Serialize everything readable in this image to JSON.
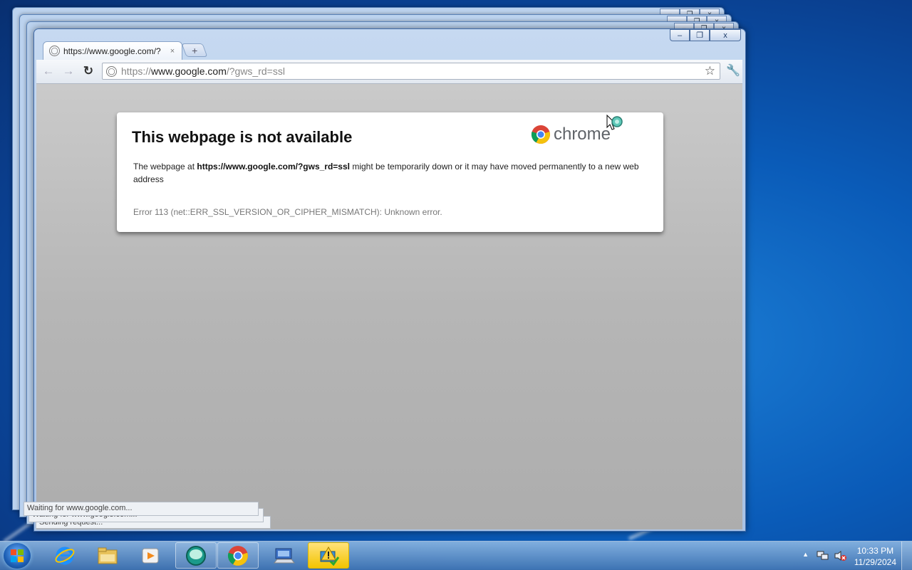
{
  "browser": {
    "tab_title": "https://www.google.com/?",
    "tab_close": "×",
    "new_tab": "+",
    "url_scheme": "https://",
    "url_host": "www.google.com",
    "url_path": "/?gws_rd=ssl",
    "back_glyph": "←",
    "forward_glyph": "→",
    "reload_glyph": "↻",
    "star_glyph": "☆",
    "wrench_glyph": "🔧",
    "minimize_glyph": "–",
    "maximize_glyph": "❐",
    "close_glyph": "x"
  },
  "error_page": {
    "title": "This webpage is not available",
    "logo_text": "chrome",
    "message_prefix": "The webpage at ",
    "message_url": "https://www.google.com/?gws_rd=ssl",
    "message_suffix": " might be temporarily down or it may have moved permanently to a new web address",
    "error_detail": "Error 113 (net::ERR_SSL_VERSION_OR_CIPHER_MISMATCH): Unknown error."
  },
  "status_bubbles": [
    "Waiting for www.google.com...",
    "Waiting for www.google.com...",
    "Sending request..."
  ],
  "taskbar": {
    "items": [
      "start-orb",
      "internet-explorer-icon",
      "file-explorer-icon",
      "media-player-icon",
      "messenger-icon",
      "chrome-icon",
      "remote-desktop-icon",
      "security-alert-icon"
    ],
    "clock_time": "10:33 PM",
    "clock_date": "11/29/2024",
    "tray_arrow": "▲"
  },
  "colors": {
    "desktop": "#0a5bb8",
    "window_frame": "#c6d9f1",
    "content_bg": "#bdbdbd"
  }
}
